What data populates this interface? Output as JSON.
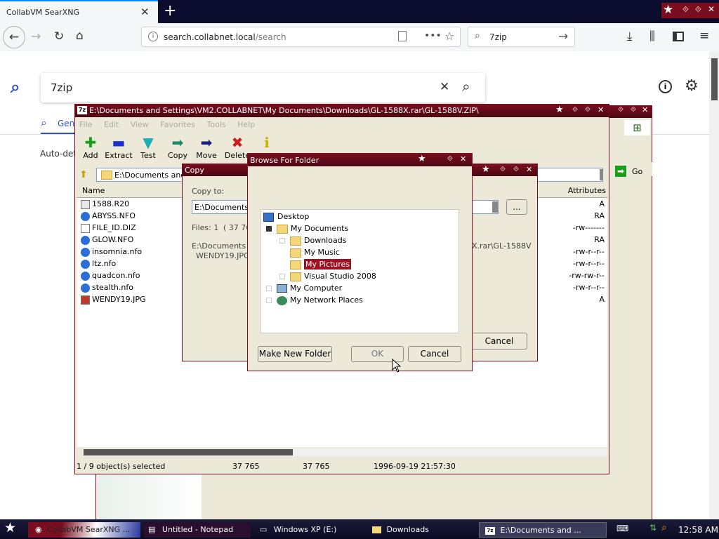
{
  "browser": {
    "tab_title": "CollabVM SearXNG",
    "tab_close": "✕",
    "new_tab": "+",
    "url_host": "search.collabnet.local",
    "url_path": "/search",
    "search_box": "7zip",
    "window_controls": [
      "⟐",
      "⟐",
      "✕"
    ]
  },
  "searxng": {
    "query": "7zip",
    "tab_general": "Gen",
    "auto_detect": "Auto-det"
  },
  "sevenzip": {
    "title": "E:\\Documents and Settings\\VM2.COLLABNET\\My Documents\\Downloads\\GL-1588X.rar\\GL-1588V.ZIP\\",
    "menu": [
      "File",
      "Edit",
      "View",
      "Favorites",
      "Tools",
      "Help"
    ],
    "toolbar": [
      {
        "label": "Add",
        "icon": "plus-icon",
        "color": "#1a9e1a",
        "glyph": "✚"
      },
      {
        "label": "Extract",
        "icon": "minus-icon",
        "color": "#1a2fd0",
        "glyph": "▬"
      },
      {
        "label": "Test",
        "icon": "check-icon",
        "color": "#1ab0b8",
        "glyph": "▼"
      },
      {
        "label": "Copy",
        "icon": "arrow-right-icon",
        "color": "#1a8a6a",
        "glyph": "➡"
      },
      {
        "label": "Move",
        "icon": "arrow-right-icon",
        "color": "#1a2080",
        "glyph": "➡"
      },
      {
        "label": "Delete",
        "icon": "delete-icon",
        "color": "#d01a1a",
        "glyph": "✖"
      },
      {
        "label": "Info",
        "icon": "info-icon",
        "color": "#c8b000",
        "glyph": "i"
      }
    ],
    "path": "E:\\Documents and S",
    "go": "Go",
    "col_name": "Name",
    "col_attributes": "Attributes",
    "files": [
      {
        "name": "1588.R20",
        "attr": "A"
      },
      {
        "name": "ABYSS.NFO",
        "attr": "RA"
      },
      {
        "name": "FILE_ID.DIZ",
        "attr": "-rw-------"
      },
      {
        "name": "GLOW.NFO",
        "attr": "RA"
      },
      {
        "name": "insomnia.nfo",
        "attr": "-rw-r--r--"
      },
      {
        "name": "ltz.nfo",
        "attr": "-rw-r--r--"
      },
      {
        "name": "quadcon.nfo",
        "attr": "-rw-rw-r--"
      },
      {
        "name": "stealth.nfo",
        "attr": "-rw-r--r--"
      },
      {
        "name": "WENDY19.JPG",
        "attr": "A"
      }
    ],
    "status": {
      "selected": "1 / 9 object(s) selected",
      "size": "37 765",
      "packed": "37 765",
      "modified": "1996-09-19 21:57:30"
    }
  },
  "copy_dialog": {
    "title": "Copy",
    "copy_to": "Copy to:",
    "path_value": "E:\\Documents a",
    "browse": "...",
    "files": "Files: 1",
    "size": "( 37 765",
    "source_line1": "E:\\Documents ar",
    "source_line2": "WENDY19.JPG",
    "source_right": "X.rar\\GL-1588V",
    "cancel": "Cancel"
  },
  "browse_dialog": {
    "title": "Browse For Folder",
    "tree": [
      {
        "label": "Desktop",
        "level": 0,
        "icon": "desktop-icon"
      },
      {
        "label": "My Documents",
        "level": 1,
        "icon": "my-documents-icon"
      },
      {
        "label": "Downloads",
        "level": 2,
        "icon": "folder-icon"
      },
      {
        "label": "My Music",
        "level": 2,
        "icon": "music-folder-icon"
      },
      {
        "label": "My Pictures",
        "level": 2,
        "icon": "pictures-folder-icon",
        "selected": true
      },
      {
        "label": "Visual Studio 2008",
        "level": 2,
        "icon": "folder-icon"
      },
      {
        "label": "My Computer",
        "level": 1,
        "icon": "computer-icon"
      },
      {
        "label": "My Network Places",
        "level": 1,
        "icon": "network-icon"
      }
    ],
    "make_new_folder": "Make New Folder",
    "ok": "OK",
    "cancel": "Cancel"
  },
  "taskbar": {
    "items": [
      {
        "label": "CollabVM SearXNG ...",
        "icon": "firefox-icon"
      },
      {
        "label": "Untitled - Notepad",
        "icon": "notepad-icon"
      },
      {
        "label": "Windows XP (E:)",
        "icon": "drive-icon"
      },
      {
        "label": "Downloads",
        "icon": "folder-icon"
      },
      {
        "label": "E:\\Documents and ...",
        "icon": "7zip-icon"
      }
    ],
    "clock": "12:58 AM"
  },
  "colors": {
    "xp_title": "#7a0e1f",
    "selection": "#a01020",
    "accent": "#0a84ff"
  }
}
